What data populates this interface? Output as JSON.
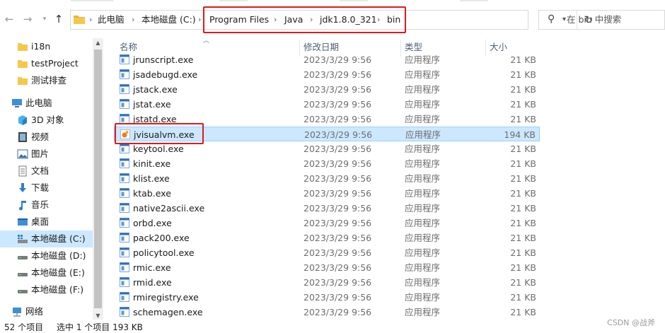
{
  "breadcrumb": [
    "此电脑",
    "本地磁盘 (C:)",
    "Program Files",
    "Java",
    "jdk1.8.0_321",
    "bin"
  ],
  "search": {
    "placeholder": "在 bin 中搜索"
  },
  "columns": {
    "name": "名称",
    "date": "修改日期",
    "type": "类型",
    "size": "大小"
  },
  "sidebar": {
    "items": [
      {
        "label": "i18n",
        "icon": "folder-icon"
      },
      {
        "label": "testProject",
        "icon": "folder-icon"
      },
      {
        "label": "测试排查",
        "icon": "folder-icon"
      },
      {
        "label": "此电脑",
        "icon": "computer-icon"
      },
      {
        "label": "3D 对象",
        "icon": "3d-objects-icon"
      },
      {
        "label": "视频",
        "icon": "video-icon"
      },
      {
        "label": "图片",
        "icon": "pictures-icon"
      },
      {
        "label": "文档",
        "icon": "documents-icon"
      },
      {
        "label": "下载",
        "icon": "download-icon"
      },
      {
        "label": "音乐",
        "icon": "music-icon"
      },
      {
        "label": "桌面",
        "icon": "desktop-icon"
      },
      {
        "label": "本地磁盘 (C:)",
        "icon": "drive-c-icon",
        "selected": true
      },
      {
        "label": "本地磁盘 (D:)",
        "icon": "drive-icon"
      },
      {
        "label": "本地磁盘 (E:)",
        "icon": "drive-icon"
      },
      {
        "label": "本地磁盘 (F:)",
        "icon": "drive-icon"
      },
      {
        "label": "网络",
        "icon": "network-icon"
      }
    ]
  },
  "files": [
    {
      "name": "jrunscript.exe",
      "date": "2023/3/29 9:56",
      "type": "应用程序",
      "size": "21 KB"
    },
    {
      "name": "jsadebugd.exe",
      "date": "2023/3/29 9:56",
      "type": "应用程序",
      "size": "21 KB"
    },
    {
      "name": "jstack.exe",
      "date": "2023/3/29 9:56",
      "type": "应用程序",
      "size": "21 KB"
    },
    {
      "name": "jstat.exe",
      "date": "2023/3/29 9:56",
      "type": "应用程序",
      "size": "21 KB"
    },
    {
      "name": "jstatd.exe",
      "date": "2023/3/29 9:56",
      "type": "应用程序",
      "size": "21 KB"
    },
    {
      "name": "jvisualvm.exe",
      "date": "2023/3/29 9:56",
      "type": "应用程序",
      "size": "194 KB",
      "selected": true
    },
    {
      "name": "keytool.exe",
      "date": "2023/3/29 9:56",
      "type": "应用程序",
      "size": "21 KB"
    },
    {
      "name": "kinit.exe",
      "date": "2023/3/29 9:56",
      "type": "应用程序",
      "size": "21 KB"
    },
    {
      "name": "klist.exe",
      "date": "2023/3/29 9:56",
      "type": "应用程序",
      "size": "21 KB"
    },
    {
      "name": "ktab.exe",
      "date": "2023/3/29 9:56",
      "type": "应用程序",
      "size": "21 KB"
    },
    {
      "name": "native2ascii.exe",
      "date": "2023/3/29 9:56",
      "type": "应用程序",
      "size": "21 KB"
    },
    {
      "name": "orbd.exe",
      "date": "2023/3/29 9:56",
      "type": "应用程序",
      "size": "21 KB"
    },
    {
      "name": "pack200.exe",
      "date": "2023/3/29 9:56",
      "type": "应用程序",
      "size": "21 KB"
    },
    {
      "name": "policytool.exe",
      "date": "2023/3/29 9:56",
      "type": "应用程序",
      "size": "21 KB"
    },
    {
      "name": "rmic.exe",
      "date": "2023/3/29 9:56",
      "type": "应用程序",
      "size": "21 KB"
    },
    {
      "name": "rmid.exe",
      "date": "2023/3/29 9:56",
      "type": "应用程序",
      "size": "21 KB"
    },
    {
      "name": "rmiregistry.exe",
      "date": "2023/3/29 9:56",
      "type": "应用程序",
      "size": "21 KB"
    },
    {
      "name": "schemagen.exe",
      "date": "2023/3/29 9:56",
      "type": "应用程序",
      "size": "21 KB"
    }
  ],
  "status": {
    "count": "52 个项目",
    "selection": "选中 1 个项目  193 KB"
  },
  "watermark": "CSDN @战斧",
  "colors": {
    "selection": "#cce8ff",
    "highlight_box": "#e0191a",
    "header_text": "#4c607a"
  }
}
